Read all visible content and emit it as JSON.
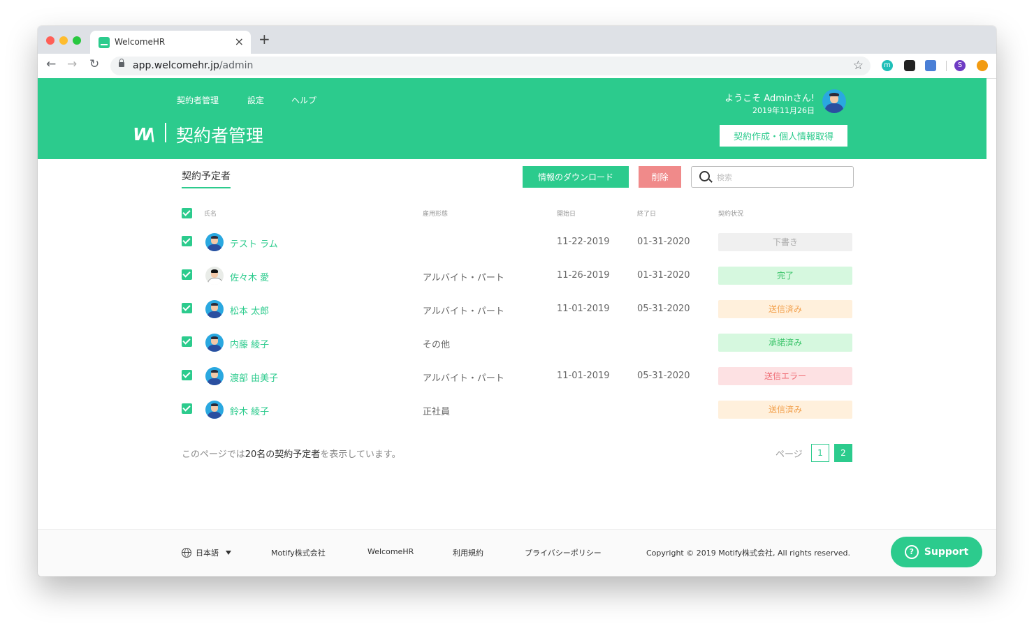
{
  "browser": {
    "tab_title": "WelcomeHR",
    "new_tab": "+",
    "tab_close": "×",
    "url_host": "app.welcomehr.jp",
    "url_path": "/admin",
    "back": "←",
    "forward": "→",
    "reload": "↻",
    "star": "☆",
    "profile_initial": "S",
    "extension_initial": "m"
  },
  "header": {
    "nav": [
      "契約者管理",
      "設定",
      "ヘルプ"
    ],
    "logo": "W\\",
    "title": "契約者管理",
    "greeting": "ようこそ Adminさん!",
    "date": "2019年11月26日",
    "create_button": "契約作成・個人情報取得"
  },
  "toolbar": {
    "tab_label": "契約予定者",
    "download_button": "情報のダウンロード",
    "delete_button": "削除",
    "search_placeholder": "検索"
  },
  "table": {
    "headers": {
      "name": "氏名",
      "employment": "雇用形態",
      "start": "開始日",
      "end": "終了日",
      "status": "契約状況"
    },
    "rows": [
      {
        "name": "テスト ラム",
        "employment": "",
        "start": "11-22-2019",
        "end": "01-31-2020",
        "status": "下書き"
      },
      {
        "name": "佐々木 愛",
        "employment": "アルバイト・パート",
        "start": "11-26-2019",
        "end": "01-31-2020",
        "status": "完了"
      },
      {
        "name": "松本 太郎",
        "employment": "アルバイト・パート",
        "start": "11-01-2019",
        "end": "05-31-2020",
        "status": "送信済み"
      },
      {
        "name": "内藤 綾子",
        "employment": "その他",
        "start": "",
        "end": "",
        "status": "承諾済み"
      },
      {
        "name": "渡部 由美子",
        "employment": "アルバイト・パート",
        "start": "11-01-2019",
        "end": "05-31-2020",
        "status": "送信エラー"
      },
      {
        "name": "鈴木 綾子",
        "employment": "正社員",
        "start": "",
        "end": "",
        "status": "送信済み"
      }
    ]
  },
  "summary": {
    "prefix": "このページでは",
    "count": "20名の契約予定者",
    "suffix": "を表示しています。"
  },
  "pagination": {
    "label": "ページ",
    "pages": [
      "1",
      "2"
    ]
  },
  "footer": {
    "language": "日本語",
    "links": [
      "Motify株式会社",
      "WelcomeHR",
      "利用規約",
      "プライバシーポリシー"
    ],
    "copyright": "Copyright © 2019 Motify株式会社, All rights reserved.",
    "help_glyph": "?",
    "support": "Support"
  },
  "colors": {
    "brand": "#2ccb8d",
    "delete": "#f08a8a",
    "status_draft": "#f0f0f0",
    "status_done": "#d6f8df",
    "status_sent": "#fff0dc",
    "status_error": "#fde1e3"
  }
}
